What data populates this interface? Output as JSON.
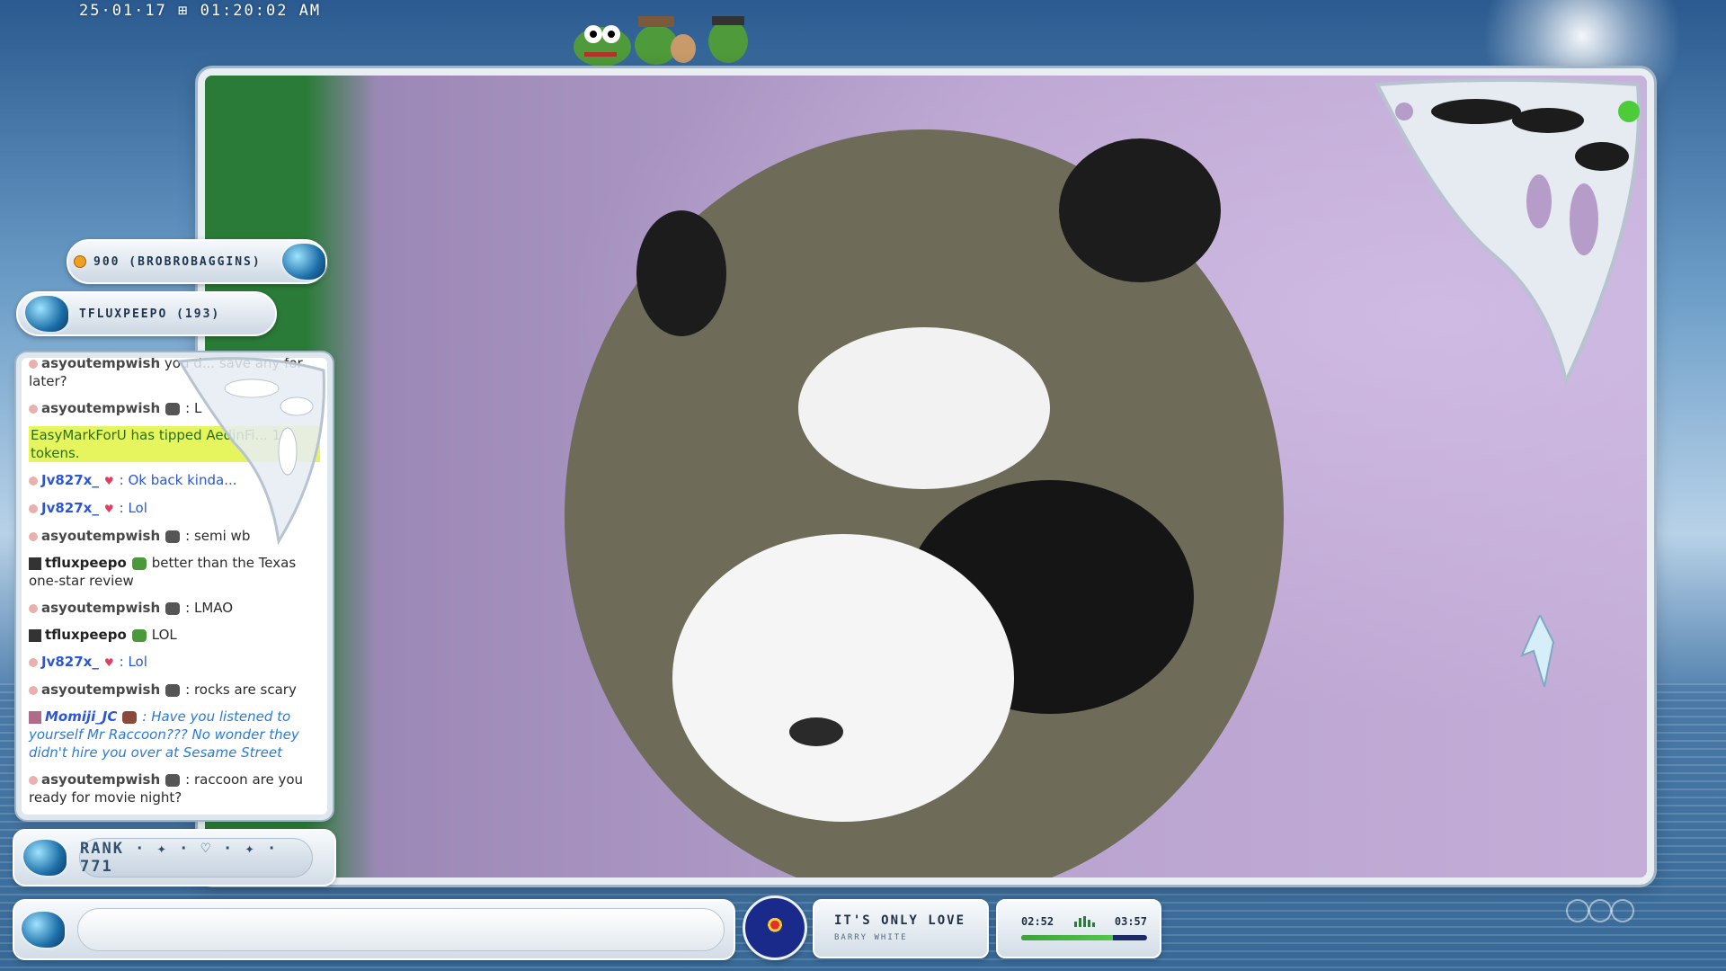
{
  "overlay": {
    "timestamp": "25·01·17 ⊞ 01:20:02 AM"
  },
  "alerts": {
    "top": "900 (BROBROBAGGINS)",
    "second": "TFLUXPEEPO (193)"
  },
  "chat": {
    "messages": [
      {
        "user": "asyoutempwish",
        "text": "you d... save any for later?",
        "kind": "partial"
      },
      {
        "user": "asyoutempwish",
        "text": ": L",
        "kind": "normal"
      },
      {
        "tip": "EasyMarkForU has tipped AedjnFi... 15 tokens."
      },
      {
        "user": "Jv827x_",
        "text": ": Ok back kinda...",
        "kind": "blue"
      },
      {
        "user": "Jv827x_",
        "text": ": Lol",
        "kind": "blue"
      },
      {
        "user": "asyoutempwish",
        "text": ": semi wb",
        "kind": "normal"
      },
      {
        "user": "tfluxpeepo",
        "text": "better than the Texas one-star review",
        "kind": "dark"
      },
      {
        "user": "asyoutempwish",
        "text": ": LMAO",
        "kind": "normal"
      },
      {
        "user": "tfluxpeepo",
        "text": "LOL",
        "kind": "dark"
      },
      {
        "user": "Jv827x_",
        "text": ": Lol",
        "kind": "blue"
      },
      {
        "user": "asyoutempwish",
        "text": ": rocks are scary",
        "kind": "normal"
      },
      {
        "user": "Momiji_JC",
        "text": ": Have you listened to yourself Mr Raccoon??? No wonder they didn't hire you over at Sesame Street",
        "kind": "italic"
      },
      {
        "user": "asyoutempwish",
        "text": ": raccoon are you ready for movie night?",
        "kind": "normal"
      }
    ]
  },
  "rank": {
    "label": "RANK · ✦ · ♡ · ✦ · 771"
  },
  "music": {
    "title": "IT'S ONLY LOVE",
    "artist": "BARRY WHITE",
    "elapsed": "02:52",
    "total": "03:57",
    "progress": 0.73
  },
  "colors": {
    "accent_green": "#3da23a",
    "chat_blue": "#2b56d6",
    "tip_highlight": "#e6f55e"
  }
}
